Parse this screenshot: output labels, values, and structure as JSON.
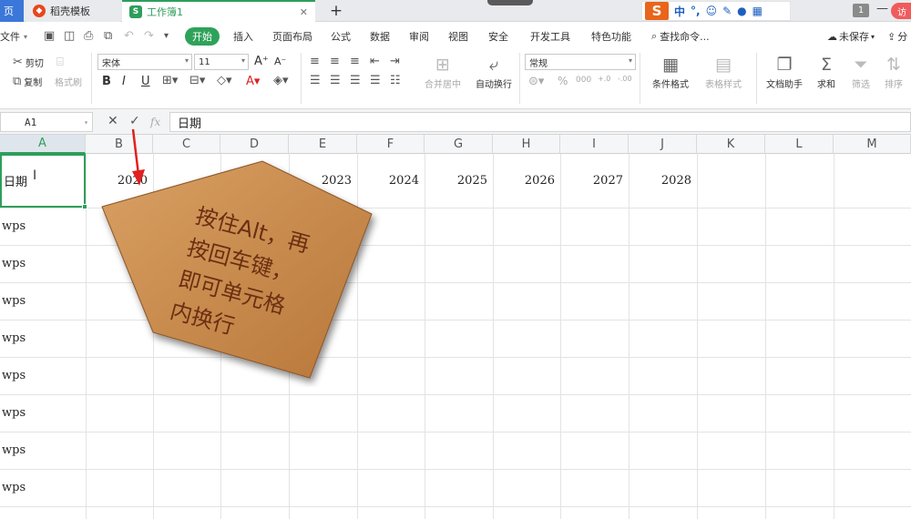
{
  "tabs": {
    "home_fragment": "页",
    "tab1_label": "稻壳模板",
    "tab2_label": "工作簿1",
    "tab2_icon": "S",
    "close_glyph": "✕",
    "new_tab": "+"
  },
  "ime": {
    "logo": "S",
    "lang": "中",
    "punct": "°,"
  },
  "titlebar": {
    "page_num": "1",
    "visitor": "访"
  },
  "menu": {
    "file": "文件",
    "items": [
      "开始",
      "插入",
      "页面布局",
      "公式",
      "数据",
      "审阅",
      "视图",
      "安全",
      "开发工具",
      "特色功能"
    ],
    "search": "查找命令...",
    "unsaved": "未保存",
    "share": "分"
  },
  "ribbon": {
    "cut": "剪切",
    "copy": "复制",
    "format_painter": "格式刷",
    "font_name": "宋体",
    "font_size": "11",
    "merge_center": "合并居中",
    "wrap_text": "自动换行",
    "number_format": "常规",
    "conditional_format": "条件格式",
    "table_style": "表格样式",
    "doc_helper": "文档助手",
    "sum": "求和",
    "filter": "筛选",
    "sort": "排序"
  },
  "formula_bar": {
    "cell_ref": "A1",
    "fx": "fx",
    "content": "日期"
  },
  "columns": [
    "A",
    "B",
    "C",
    "D",
    "E",
    "F",
    "G",
    "H",
    "I",
    "J",
    "K",
    "L",
    "M"
  ],
  "sheet": {
    "a1": "日期",
    "b1": "2020",
    "years": [
      "2023",
      "2024",
      "2025",
      "2026",
      "2027",
      "2028"
    ],
    "col_a_values": [
      "wps",
      "wps",
      "wps",
      "wps",
      "wps",
      "wps",
      "wps",
      "wps"
    ]
  },
  "annotation": {
    "lines": [
      "按住Alt，再",
      "按回车键，",
      "即可单元格",
      "内换行"
    ]
  },
  "colors": {
    "accent": "#2e9e5b",
    "note_fill": "#c98a4a",
    "arrow": "#e02020",
    "tab_blue": "#3a77d8"
  }
}
